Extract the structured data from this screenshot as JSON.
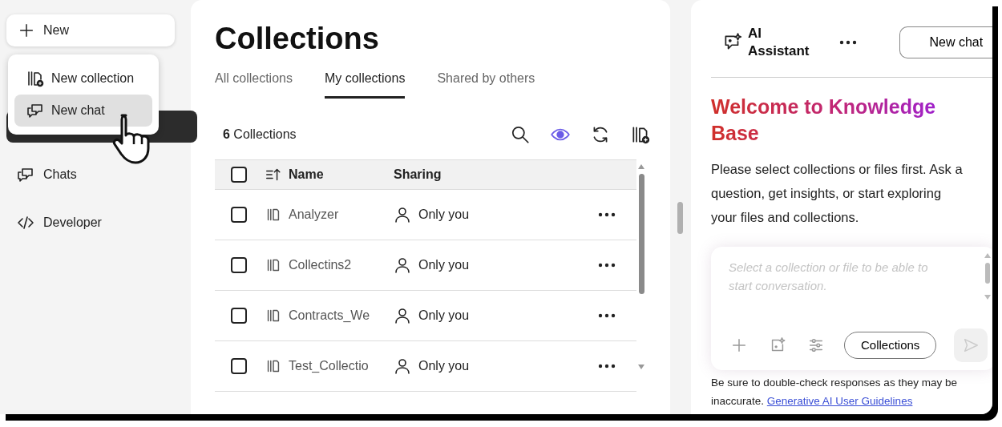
{
  "new_button": {
    "label": "New"
  },
  "new_menu": {
    "items": [
      {
        "label": "New collection",
        "kind": "collection",
        "selected": false
      },
      {
        "label": "New chat",
        "kind": "chat",
        "selected": true
      }
    ]
  },
  "sidebar": {
    "items": [
      {
        "label": "Chats",
        "kind": "chats"
      },
      {
        "label": "Developer",
        "kind": "developer"
      }
    ]
  },
  "main": {
    "title": "Collections",
    "tabs": [
      {
        "label": "All collections",
        "selected": false
      },
      {
        "label": "My collections",
        "selected": true
      },
      {
        "label": "Shared by others",
        "selected": false
      }
    ],
    "count": "**6** Collections",
    "toolbar": [
      {
        "kind": "search",
        "active": false
      },
      {
        "kind": "view",
        "active": true
      },
      {
        "kind": "refresh",
        "active": false
      },
      {
        "kind": "add-collection",
        "active": false
      }
    ],
    "table": {
      "header_checked": false,
      "columns": [
        "Name",
        "Sharing"
      ],
      "rows": [
        {
          "name": "Analyzer",
          "sharing": "Only you",
          "checked": false
        },
        {
          "name": "Collectins2",
          "sharing": "Only you",
          "checked": false
        },
        {
          "name": "Contracts_We",
          "sharing": "Only you",
          "checked": false
        },
        {
          "name": "Test_Collectio",
          "sharing": "Only you",
          "checked": false
        }
      ]
    }
  },
  "assistant": {
    "title": "AI Assistant",
    "new_chat_button": "New chat",
    "heading": "Welcome to Knowledge Base",
    "intro": "Please select collections or files first. Ask a question, get insights, or start exploring your files and collections.",
    "input": {
      "placeholder": "Select a collection or file to be able to start conversation.",
      "collections_button": "Collections",
      "send_disabled": true
    },
    "disclaimer": "Be sure to double-check responses as they may be inaccurate.",
    "link": "Generative AI User Guidelines"
  }
}
